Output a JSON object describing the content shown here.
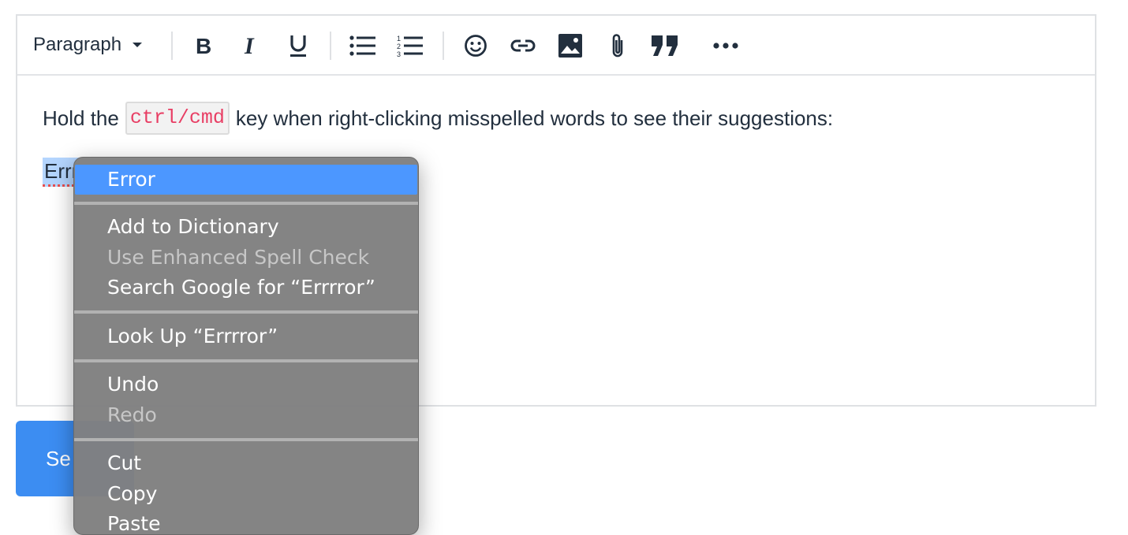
{
  "toolbar": {
    "format_label": "Paragraph",
    "buttons": [
      "bold-icon",
      "italic-icon",
      "underline-icon",
      "bullet-list-icon",
      "numbered-list-icon",
      "emoji-icon",
      "link-icon",
      "image-icon",
      "attachment-icon",
      "quote-icon",
      "more-icon"
    ]
  },
  "content": {
    "before_code": "Hold the",
    "code": "ctrl/cmd",
    "after_code": "key when right-clicking misspelled words to see their suggestions:",
    "misspelled_visible": "Errr"
  },
  "send_button": {
    "label": "Se"
  },
  "context_menu": {
    "suggestion": "Error",
    "add_to_dictionary": "Add to Dictionary",
    "enhanced_spell_check": "Use Enhanced Spell Check",
    "search_google": "Search Google for “Errrror”",
    "look_up": "Look Up “Errrror”",
    "undo": "Undo",
    "redo": "Redo",
    "cut": "Cut",
    "copy": "Copy",
    "paste": "Paste"
  },
  "colors": {
    "accent": "#3c8df2",
    "selection": "#4c97ff",
    "code_text": "#e83e64",
    "text": "#222f3e"
  }
}
